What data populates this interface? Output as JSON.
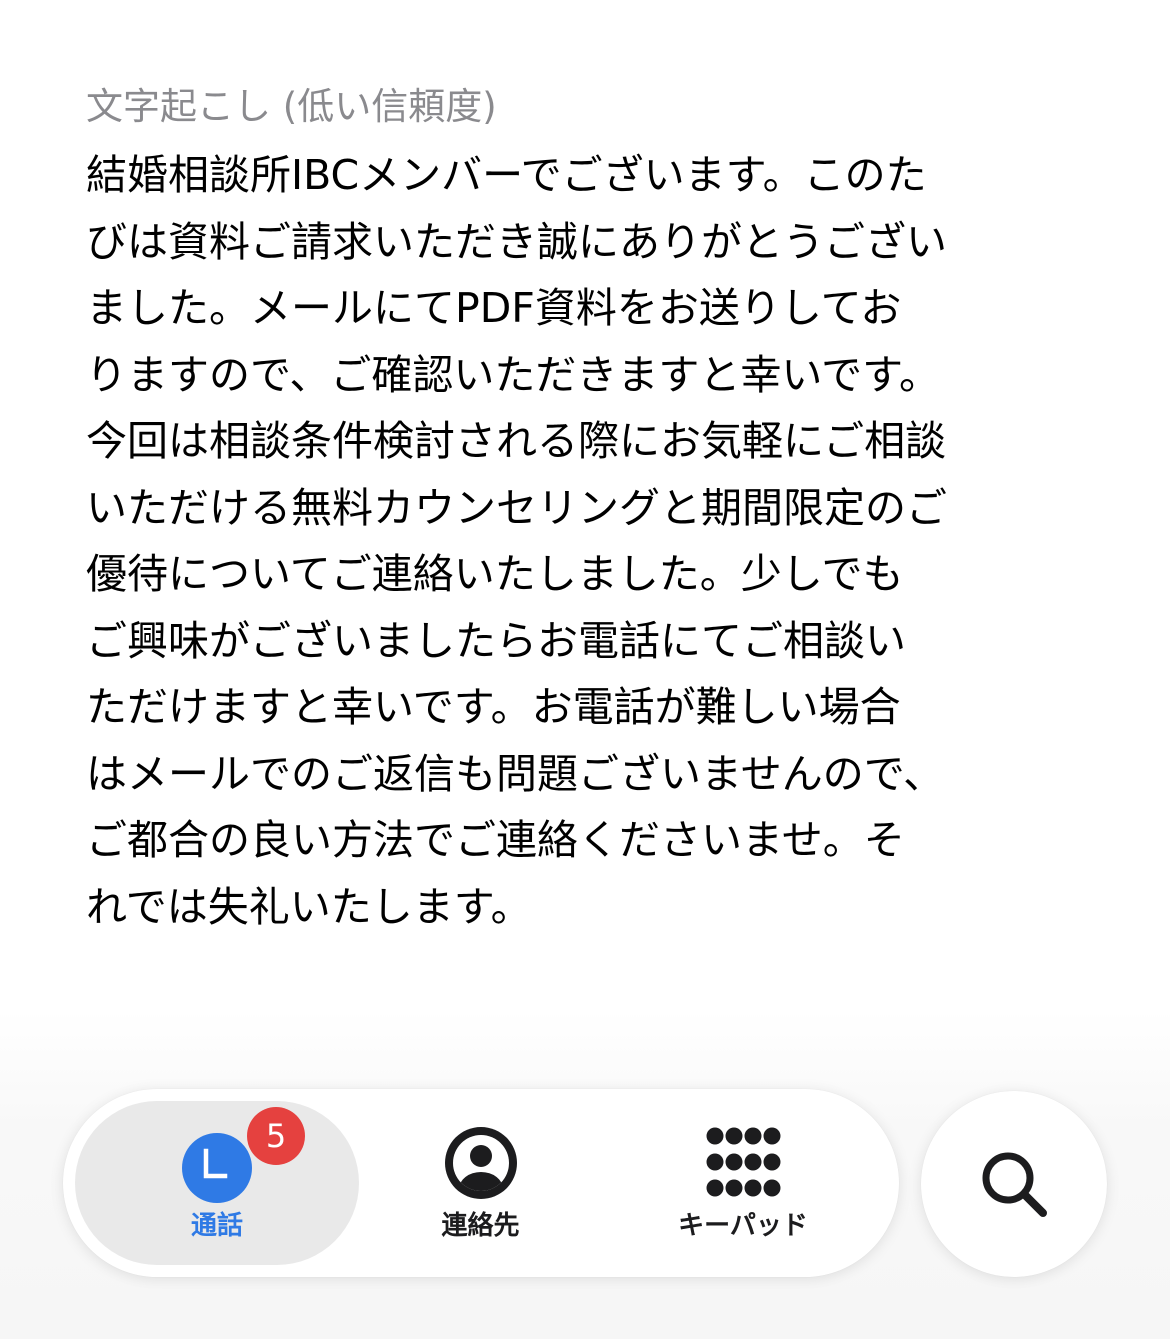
{
  "transcript": {
    "label": "文字起こし (低い信頼度)",
    "lines": [
      "結婚相談所IBCメンバーでございます。このた",
      "びは資料ご請求いただき誠にありがとうござい",
      "ました。メールにてPDF資料をお送りしてお",
      "りますので、ご確認いただきますと幸いです。",
      "今回は相談条件検討される際にお気軽にご相談",
      "いただける無料カウンセリングと期間限定のご",
      "優待についてご連絡いたしました。少しでも",
      "ご興味がございましたらお電話にてご相談い",
      "ただけますと幸いです。お電話が難しい場合",
      "はメールでのご返信も問題ございませんので、",
      "ご都合の良い方法でご連絡くださいませ。そ",
      "れでは失礼いたします。"
    ]
  },
  "tab_bar": {
    "calls": {
      "label": "通話",
      "badge": "5",
      "icon": "clock-icon",
      "selected": true
    },
    "contacts": {
      "label": "連絡先",
      "icon": "person-circle-icon"
    },
    "keypad": {
      "label": "キーパッド",
      "icon": "keypad-icon"
    }
  },
  "search_button": {
    "icon": "search-icon"
  },
  "colors": {
    "accent": "#2f7ae5",
    "badge": "#e5413f",
    "secondary_text": "#8a8a8e",
    "selected_tab_bg": "#e9e9e9"
  }
}
